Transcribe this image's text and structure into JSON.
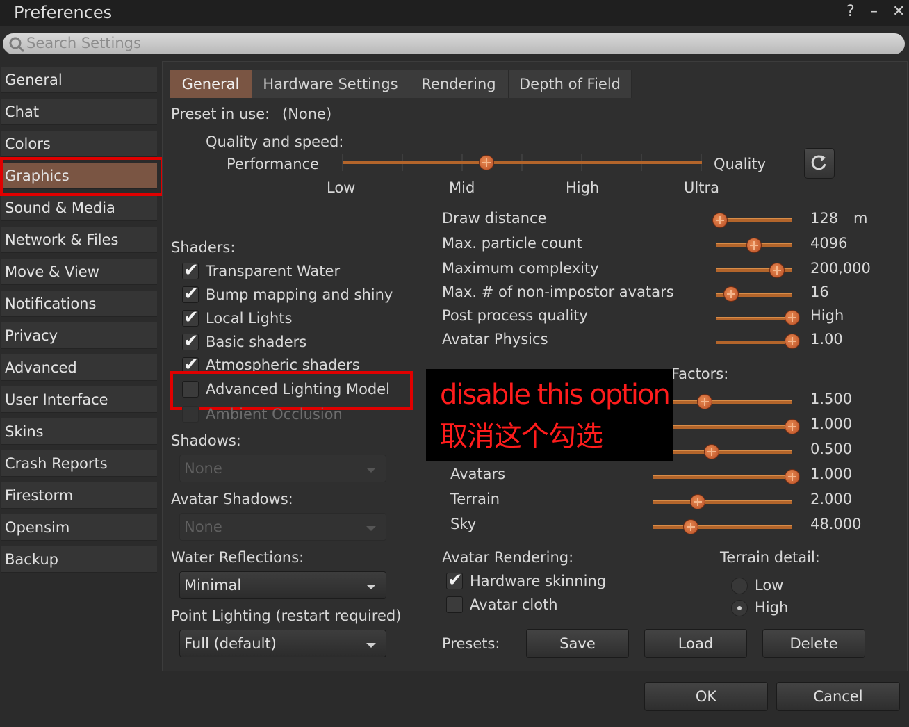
{
  "window": {
    "title": "Preferences",
    "help": "?",
    "minimize": "–",
    "close": "✕"
  },
  "search": {
    "placeholder": "Search Settings"
  },
  "sidebar": {
    "items": [
      {
        "label": "General"
      },
      {
        "label": "Chat"
      },
      {
        "label": "Colors"
      },
      {
        "label": "Graphics"
      },
      {
        "label": "Sound & Media"
      },
      {
        "label": "Network & Files"
      },
      {
        "label": "Move & View"
      },
      {
        "label": "Notifications"
      },
      {
        "label": "Privacy"
      },
      {
        "label": "Advanced"
      },
      {
        "label": "User Interface"
      },
      {
        "label": "Skins"
      },
      {
        "label": "Crash Reports"
      },
      {
        "label": "Firestorm"
      },
      {
        "label": "Opensim"
      },
      {
        "label": "Backup"
      }
    ],
    "selected": "Graphics"
  },
  "tabs": [
    {
      "label": "General"
    },
    {
      "label": "Hardware Settings"
    },
    {
      "label": "Rendering"
    },
    {
      "label": "Depth of Field"
    }
  ],
  "preset": {
    "label": "Preset in use:",
    "value": "(None)"
  },
  "quality": {
    "heading": "Quality and speed:",
    "left": "Performance",
    "right": "Quality",
    "ticks": [
      "Low",
      "Mid",
      "High",
      "Ultra"
    ],
    "level": 0.4
  },
  "shaders": {
    "heading": "Shaders:",
    "items": [
      {
        "label": "Transparent Water",
        "checked": true
      },
      {
        "label": "Bump mapping and shiny",
        "checked": true
      },
      {
        "label": "Local Lights",
        "checked": true
      },
      {
        "label": "Basic shaders",
        "checked": true
      },
      {
        "label": "Atmospheric shaders",
        "checked": true
      },
      {
        "label": "Advanced Lighting Model",
        "checked": false
      },
      {
        "label": "Ambient Occlusion",
        "checked": false
      }
    ]
  },
  "shadows": {
    "label": "Shadows:",
    "value": "None"
  },
  "avatar_shadows": {
    "label": "Avatar Shadows:",
    "value": "None"
  },
  "water_reflections": {
    "label": "Water Reflections:",
    "value": "Minimal"
  },
  "point_lighting": {
    "label": "Point Lighting (restart required)",
    "value": "Full (default)"
  },
  "sliders": [
    {
      "label": "Draw distance",
      "value": "128",
      "unit": "m",
      "level": 0.05
    },
    {
      "label": "Max. particle count",
      "value": "4096",
      "level": 0.5
    },
    {
      "label": "Maximum complexity",
      "value": "200,000",
      "level": 0.8
    },
    {
      "label": "Max. # of non-impostor avatars",
      "value": "16",
      "level": 0.2
    },
    {
      "label": "Post process quality",
      "value": "High",
      "level": 1.0
    },
    {
      "label": "Avatar Physics",
      "value": "1.00",
      "level": 1.0
    }
  ],
  "lod": {
    "heading": "Factors:",
    "rows": [
      {
        "label": "",
        "value": "1.500",
        "level": 0.37
      },
      {
        "label": "",
        "value": "1.000",
        "level": 1.0
      },
      {
        "label": "",
        "value": "0.500",
        "level": 0.42
      },
      {
        "label": "Avatars",
        "value": "1.000",
        "level": 1.0
      },
      {
        "label": "Terrain",
        "value": "2.000",
        "level": 0.32
      },
      {
        "label": "Sky",
        "value": "48.000",
        "level": 0.27
      }
    ]
  },
  "avatar_rendering": {
    "heading": "Avatar Rendering:",
    "items": [
      {
        "label": "Hardware skinning",
        "checked": true
      },
      {
        "label": "Avatar cloth",
        "checked": false
      }
    ]
  },
  "terrain_detail": {
    "heading": "Terrain detail:",
    "options": [
      {
        "label": "Low"
      },
      {
        "label": "High"
      }
    ],
    "selected": "High"
  },
  "presets": {
    "label": "Presets:",
    "save": "Save",
    "load": "Load",
    "delete": "Delete"
  },
  "footer": {
    "ok": "OK",
    "cancel": "Cancel"
  },
  "annotation": {
    "line1": "disable this option",
    "line2": "取消这个勾选"
  },
  "colors": {
    "accent": "#7a5543",
    "slider": "#b3652b",
    "highlight": "#e00000"
  }
}
